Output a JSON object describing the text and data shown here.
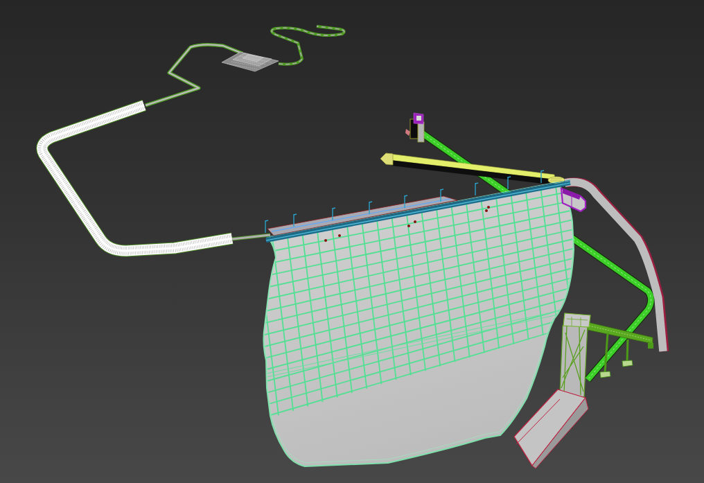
{
  "viewport": {
    "objects": [
      {
        "kind": "road"
      },
      {
        "kind": "building"
      },
      {
        "kind": "tunnel"
      },
      {
        "kind": "pipe"
      },
      {
        "kind": "channel"
      },
      {
        "kind": "belt"
      },
      {
        "kind": "intake"
      },
      {
        "kind": "slope"
      },
      {
        "kind": "crest"
      },
      {
        "kind": "gate"
      },
      {
        "kind": "bridge"
      },
      {
        "kind": "tower"
      },
      {
        "kind": "chute"
      }
    ]
  }
}
